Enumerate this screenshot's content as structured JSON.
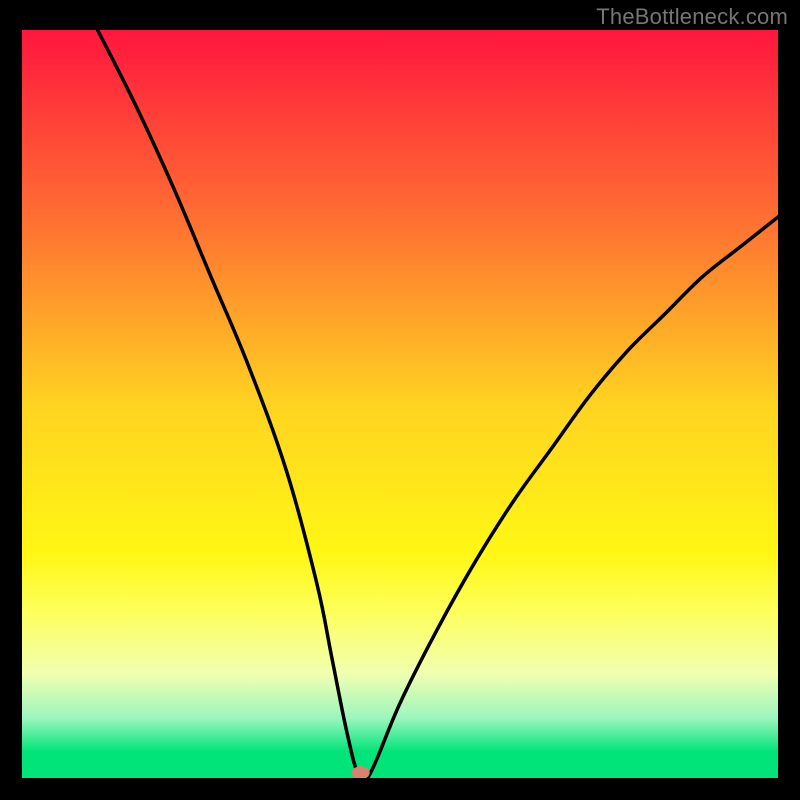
{
  "attribution": "TheBottleneck.com",
  "chart_data": {
    "type": "line",
    "title": "",
    "xlabel": "",
    "ylabel": "",
    "xlim": [
      0,
      100
    ],
    "ylim": [
      0,
      100
    ],
    "x": [
      10,
      15,
      20,
      25,
      30,
      35,
      39,
      41,
      43,
      44.5,
      46,
      50,
      55,
      60,
      65,
      70,
      75,
      80,
      85,
      90,
      95,
      100
    ],
    "values": [
      100,
      90,
      79,
      67,
      55,
      41,
      26,
      16,
      6,
      0.5,
      0.5,
      10,
      20,
      29,
      37,
      44,
      51,
      57,
      62,
      67,
      71,
      75
    ],
    "marker": {
      "x": 44.8,
      "y": 0.7
    },
    "gradient_stops": [
      {
        "pos": 0.0,
        "color": "#ff163e"
      },
      {
        "pos": 0.25,
        "color": "#ff6e32"
      },
      {
        "pos": 0.5,
        "color": "#ffd321"
      },
      {
        "pos": 0.7,
        "color": "#fff714"
      },
      {
        "pos": 0.78,
        "color": "#fdff5e"
      },
      {
        "pos": 0.86,
        "color": "#f1ffb0"
      },
      {
        "pos": 0.92,
        "color": "#9bf6bd"
      },
      {
        "pos": 0.965,
        "color": "#00e47a"
      },
      {
        "pos": 1.0,
        "color": "#00e47a"
      }
    ]
  }
}
